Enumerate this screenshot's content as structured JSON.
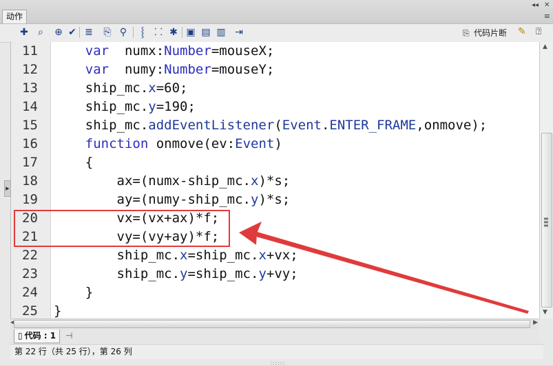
{
  "panel": {
    "title": "动作"
  },
  "titlebar": {
    "collapse_glyph": "◂◂",
    "close_glyph": "✕",
    "menu_glyph": "≡"
  },
  "toolbar": {
    "snippets_label": "代码片断",
    "tools": [
      {
        "name": "add-statement-icon",
        "glyph": "✚"
      },
      {
        "name": "find-icon",
        "glyph": "⌕"
      },
      {
        "name": "target-icon",
        "glyph": "⊕"
      },
      {
        "name": "check-syntax-icon",
        "glyph": "✔"
      },
      {
        "name": "auto-format-icon",
        "glyph": "≣"
      },
      {
        "name": "code-hint-icon",
        "glyph": "⎘"
      },
      {
        "name": "debug-options-icon",
        "glyph": "⚲"
      },
      {
        "name": "collapse-between-braces-icon",
        "glyph": "⸾"
      },
      {
        "name": "collapse-selection-icon",
        "glyph": "⸬"
      },
      {
        "name": "expand-all-icon",
        "glyph": "✱"
      },
      {
        "name": "apply-block-comment-icon",
        "glyph": "▣"
      },
      {
        "name": "apply-line-comment-icon",
        "glyph": "▤"
      },
      {
        "name": "remove-comment-icon",
        "glyph": "▥"
      },
      {
        "name": "show-hide-toolbox-icon",
        "glyph": "⇥"
      }
    ]
  },
  "editor": {
    "lines": [
      {
        "num": "11",
        "indent": "    ",
        "parts": [
          [
            "kw",
            "var"
          ],
          [
            "",
            "  numx:"
          ],
          [
            "kw",
            "Number"
          ],
          [
            "",
            "=mouseX;"
          ]
        ]
      },
      {
        "num": "12",
        "indent": "    ",
        "parts": [
          [
            "kw",
            "var"
          ],
          [
            "",
            "  numy:"
          ],
          [
            "kw",
            "Number"
          ],
          [
            "",
            "=mouseY;"
          ]
        ]
      },
      {
        "num": "13",
        "indent": "    ",
        "parts": [
          [
            "",
            "ship_mc."
          ],
          [
            "prop",
            "x"
          ],
          [
            "",
            "=60;"
          ]
        ]
      },
      {
        "num": "14",
        "indent": "    ",
        "parts": [
          [
            "",
            "ship_mc."
          ],
          [
            "prop",
            "y"
          ],
          [
            "",
            "=190;"
          ]
        ]
      },
      {
        "num": "15",
        "indent": "    ",
        "parts": [
          [
            "",
            "ship_mc."
          ],
          [
            "prop",
            "addEventListener"
          ],
          [
            "",
            "("
          ],
          [
            "prop",
            "Event"
          ],
          [
            "",
            "."
          ],
          [
            "prop",
            "ENTER_FRAME"
          ],
          [
            "",
            ",onmove);"
          ]
        ]
      },
      {
        "num": "16",
        "indent": "    ",
        "parts": [
          [
            "kw",
            "function"
          ],
          [
            "",
            " onmove(ev:"
          ],
          [
            "prop",
            "Event"
          ],
          [
            "",
            ")"
          ]
        ]
      },
      {
        "num": "17",
        "indent": "    ",
        "parts": [
          [
            "",
            "{"
          ]
        ]
      },
      {
        "num": "18",
        "indent": "        ",
        "parts": [
          [
            "",
            "ax=(numx-ship_mc."
          ],
          [
            "prop",
            "x"
          ],
          [
            "",
            ")*s;"
          ]
        ]
      },
      {
        "num": "19",
        "indent": "        ",
        "parts": [
          [
            "",
            "ay=(numy-ship_mc."
          ],
          [
            "prop",
            "y"
          ],
          [
            "",
            ")*s;"
          ]
        ]
      },
      {
        "num": "20",
        "indent": "        ",
        "parts": [
          [
            "",
            "vx=(vx+ax)*f;"
          ]
        ]
      },
      {
        "num": "21",
        "indent": "        ",
        "parts": [
          [
            "",
            "vy=(vy+ay)*f;"
          ]
        ]
      },
      {
        "num": "22",
        "indent": "        ",
        "parts": [
          [
            "",
            "ship_mc."
          ],
          [
            "prop",
            "x"
          ],
          [
            "",
            "=ship_mc."
          ],
          [
            "prop",
            "x"
          ],
          [
            "",
            "+vx;"
          ]
        ]
      },
      {
        "num": "23",
        "indent": "        ",
        "parts": [
          [
            "",
            "ship_mc."
          ],
          [
            "prop",
            "y"
          ],
          [
            "",
            "=ship_mc."
          ],
          [
            "prop",
            "y"
          ],
          [
            "",
            "+vy;"
          ]
        ]
      },
      {
        "num": "24",
        "indent": "    ",
        "parts": [
          [
            "",
            "}"
          ]
        ]
      },
      {
        "num": "25",
        "indent": "",
        "parts": [
          [
            "",
            "}"
          ]
        ]
      }
    ]
  },
  "bottom_tab": {
    "label": "代码 : 1",
    "file_icon": "▯",
    "pin_icon": "⊣"
  },
  "status": {
    "text": "第 22 行（共 25 行），第 26 列"
  },
  "annotation": {
    "color": "#e03b3b",
    "highlighted_lines": [
      "20",
      "21"
    ]
  }
}
